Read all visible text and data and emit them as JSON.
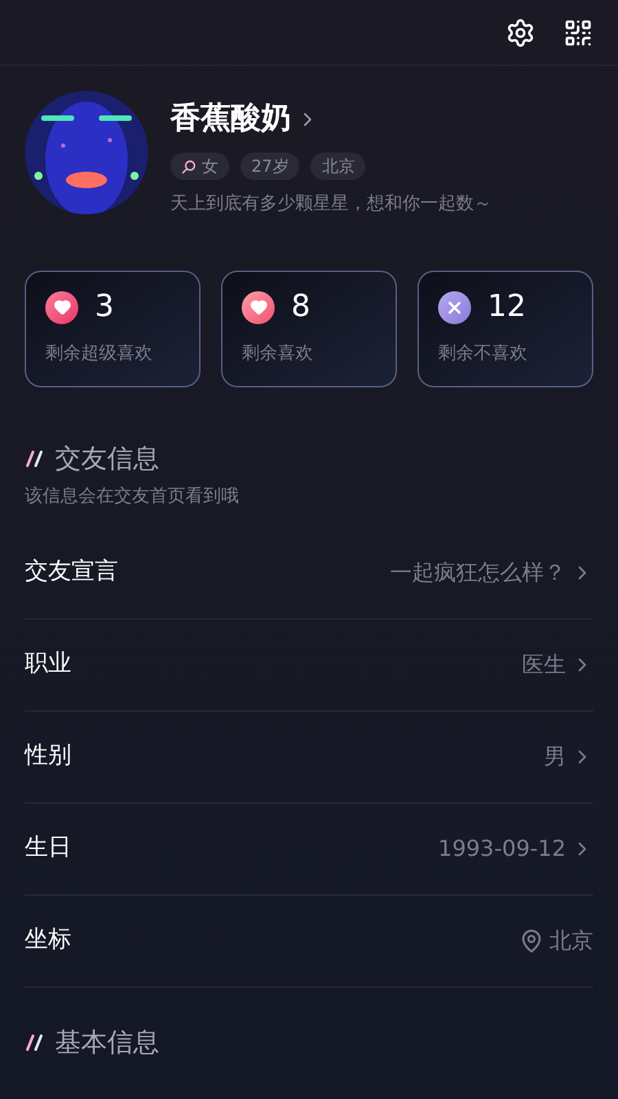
{
  "profile": {
    "name": "香蕉酸奶",
    "tags": [
      {
        "kind": "gender",
        "label": "女"
      },
      {
        "kind": "plain",
        "label": "27岁"
      },
      {
        "kind": "plain",
        "label": "北京"
      }
    ],
    "bio": "天上到底有多少颗星星，想和你一起数～"
  },
  "stats": [
    {
      "kind": "super_like",
      "count": "3",
      "label": "剩余超级喜欢"
    },
    {
      "kind": "like",
      "count": "8",
      "label": "剩余喜欢"
    },
    {
      "kind": "dislike",
      "count": "12",
      "label": "剩余不喜欢"
    }
  ],
  "dating_section": {
    "title": "交友信息",
    "subtitle": "该信息会在交友首页看到哦",
    "rows": [
      {
        "kind": "chevron",
        "label": "交友宣言",
        "value": "一起疯狂怎么样？"
      },
      {
        "kind": "chevron",
        "label": "职业",
        "value": "医生"
      },
      {
        "kind": "chevron",
        "label": "性别",
        "value": "男"
      },
      {
        "kind": "chevron",
        "label": "生日",
        "value": "1993-09-12"
      },
      {
        "kind": "location",
        "label": "坐标",
        "value": "北京"
      }
    ]
  },
  "basic_section": {
    "title": "基本信息"
  }
}
